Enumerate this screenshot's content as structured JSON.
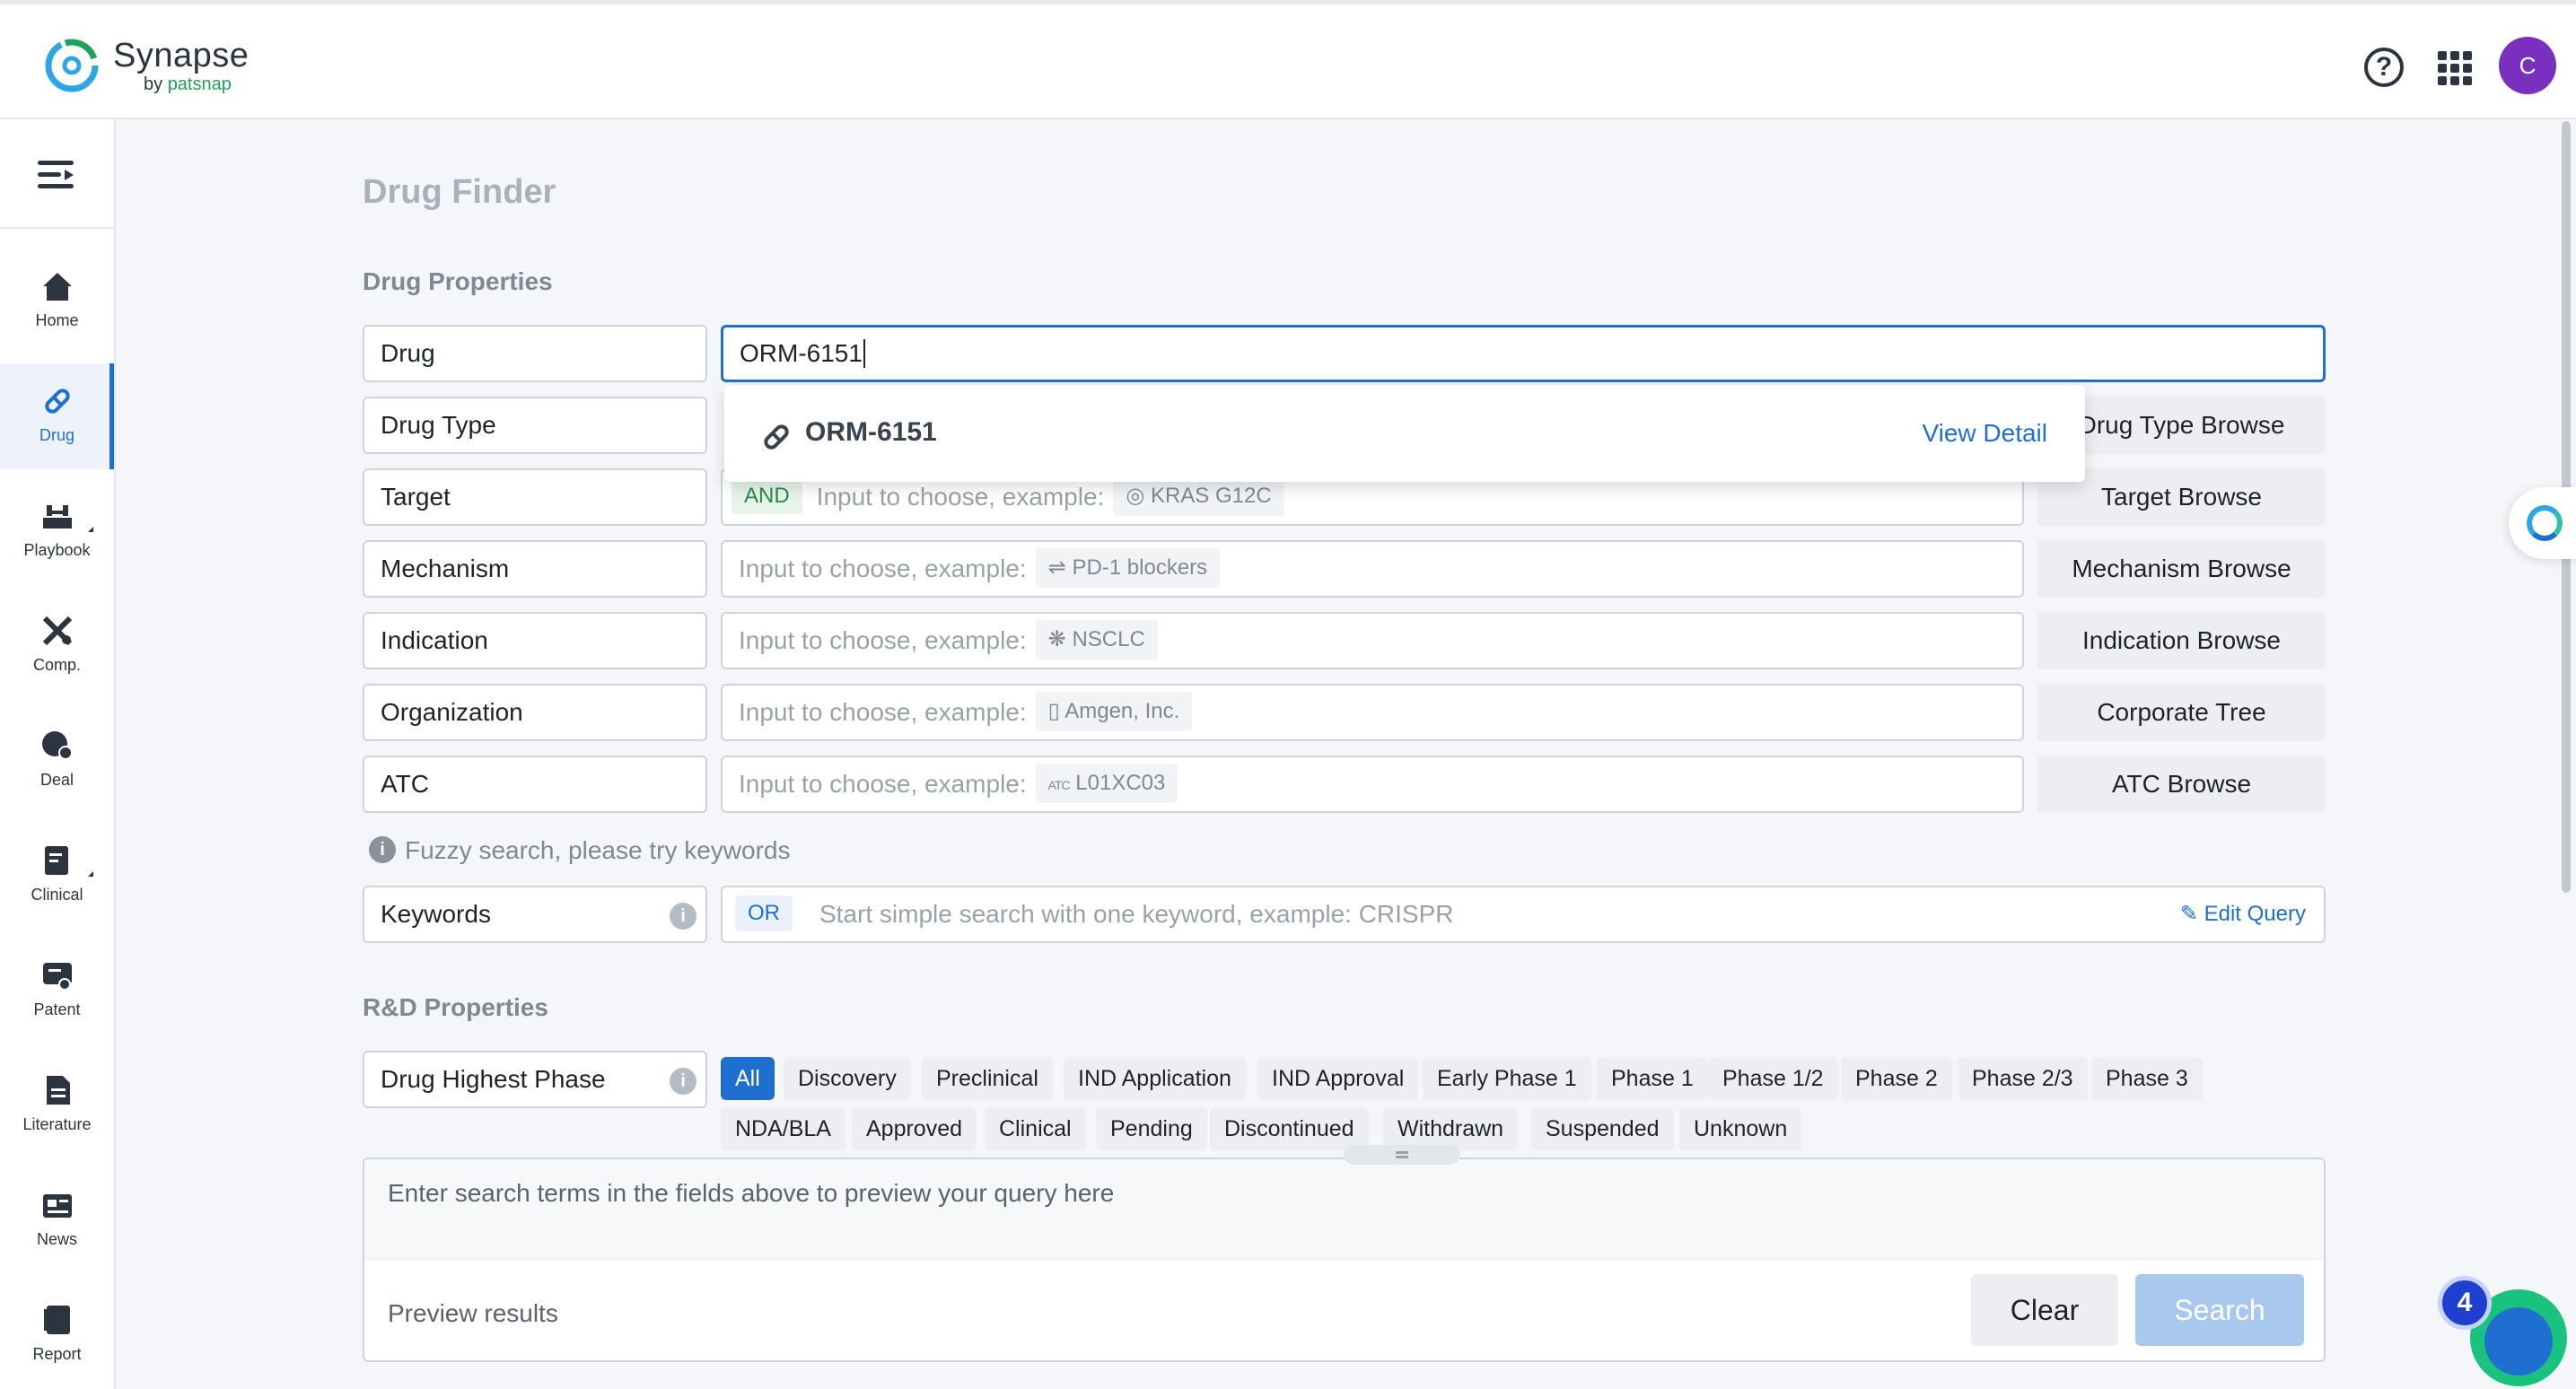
{
  "brand": {
    "name": "Synapse",
    "by": "by",
    "company": "patsnap"
  },
  "header": {
    "help_glyph": "?",
    "avatar_initial": "C"
  },
  "sidebar": {
    "items": [
      {
        "label": "Home",
        "icon": "home-icon"
      },
      {
        "label": "Drug",
        "icon": "pill-icon",
        "active": true
      },
      {
        "label": "Playbook",
        "icon": "playbook-icon"
      },
      {
        "label": "Comp.",
        "icon": "competition-icon"
      },
      {
        "label": "Deal",
        "icon": "deal-icon"
      },
      {
        "label": "Clinical",
        "icon": "clinical-icon"
      },
      {
        "label": "Patent",
        "icon": "patent-icon"
      },
      {
        "label": "Literature",
        "icon": "literature-icon"
      },
      {
        "label": "News",
        "icon": "news-icon"
      },
      {
        "label": "Report",
        "icon": "report-icon"
      }
    ]
  },
  "page": {
    "title": "Drug Finder"
  },
  "drug_properties": {
    "title": "Drug Properties",
    "drug": {
      "label": "Drug",
      "value": "ORM-6151"
    },
    "dropdown": {
      "option": "ORM-6151",
      "view_detail": "View Detail"
    },
    "drug_type": {
      "label": "Drug Type",
      "browse": "Drug Type Browse"
    },
    "target": {
      "label": "Target",
      "tag": "AND",
      "placeholder": "Input to choose, example:",
      "example": "KRAS G12C",
      "browse": "Target Browse"
    },
    "mechanism": {
      "label": "Mechanism",
      "placeholder": "Input to choose, example:",
      "example": "PD-1 blockers",
      "browse": "Mechanism Browse"
    },
    "indication": {
      "label": "Indication",
      "placeholder": "Input to choose, example:",
      "example": "NSCLC",
      "browse": "Indication Browse"
    },
    "organization": {
      "label": "Organization",
      "placeholder": "Input to choose, example:",
      "example": "Amgen, Inc.",
      "browse": "Corporate Tree"
    },
    "atc": {
      "label": "ATC",
      "placeholder": "Input to choose, example:",
      "example_prefix": "ATC",
      "example": "L01XC03",
      "browse": "ATC Browse"
    },
    "hint": "Fuzzy search, please try keywords",
    "keywords": {
      "label": "Keywords",
      "tag": "OR",
      "placeholder": "Start simple search with one keyword, example:  CRISPR",
      "edit": "Edit Query"
    }
  },
  "rd_properties": {
    "title": "R&D Properties",
    "phase_label": "Drug Highest Phase",
    "phases_row1": [
      "All",
      "Discovery",
      "Preclinical",
      "IND Application",
      "IND Approval",
      "Early Phase 1",
      "Phase 1",
      "Phase 1/2",
      "Phase 2",
      "Phase 2/3",
      "Phase 3"
    ],
    "phases_row2": [
      "NDA/BLA",
      "Approved",
      "Clinical",
      "Pending",
      "Discontinued",
      "Withdrawn",
      "Suspended",
      "Unknown"
    ],
    "selected": "All"
  },
  "preview": {
    "placeholder": "Enter search terms in the fields above to preview your query here",
    "results_label": "Preview results",
    "clear": "Clear",
    "search": "Search"
  },
  "notification": {
    "count": "4"
  },
  "colors": {
    "accent": "#1f6fd1",
    "brand_green": "#1fa15a",
    "avatar": "#7b2fbf"
  }
}
